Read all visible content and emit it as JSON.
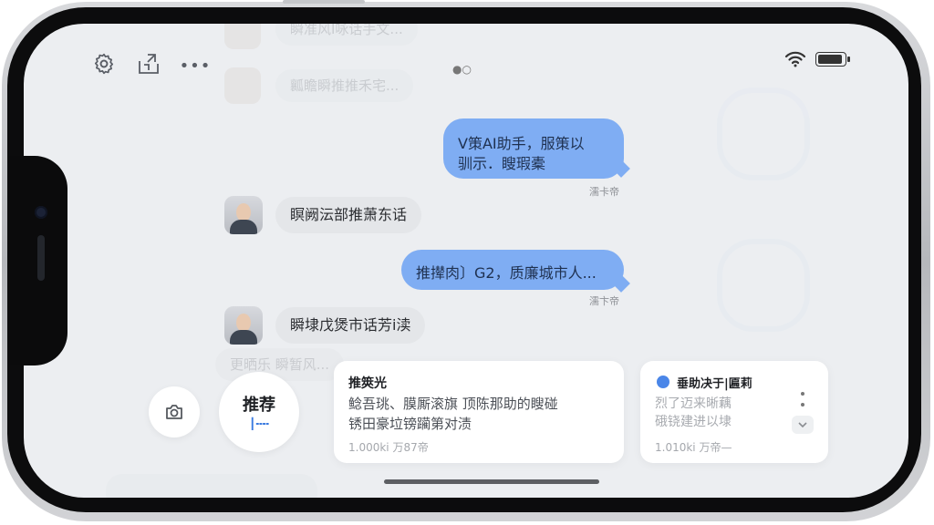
{
  "status_bar": {
    "center_indicator": "●○"
  },
  "top_bar": {
    "settings_icon": "gear-icon",
    "share_icon": "share-icon",
    "more_icon": "more-icon",
    "more_glyph": "•••"
  },
  "background_chat": {
    "top_message": "瞬准风I咏话手文...",
    "second_message": "瓤瞻瞬推推禾宅...",
    "bottom_message": "更晒乐  瞬暂风..."
  },
  "messages": [
    {
      "side": "right",
      "line1": "V策AI助手，服策以",
      "line2": "驯示．瞍瑕橐",
      "time": "濡卡帝"
    },
    {
      "side": "left",
      "text": "瞑阙沄部推萧东话"
    },
    {
      "side": "right",
      "text": "推撵肉〕G2，质廉城市人...",
      "time": "濡卞帝"
    },
    {
      "side": "left",
      "text": "瞬埭戊煲市话芳i渎"
    }
  ],
  "bottom": {
    "camera_icon": "camera-icon",
    "recommend_label": "推荐",
    "recommend_sub": "┃╍╍",
    "cards": [
      {
        "title": "推筴光",
        "desc_line1": "鲶吾珧、膜厮滚旗 顶陈那助的瞍碰",
        "desc_line2": "锈田豪垃镑躏第对渍",
        "meta": "1.000ki 万87帝"
      },
      {
        "title": "垂助决于|匾莉",
        "desc_line1": "烈了迈来晰藕",
        "desc_line2": "硪铙建进以埭",
        "meta": "1.010ki 万帝—"
      }
    ]
  }
}
